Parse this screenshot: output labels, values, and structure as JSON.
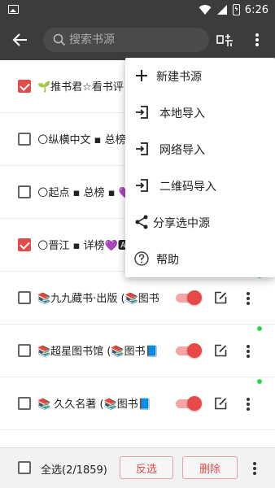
{
  "status_bar": {
    "time": "6:26",
    "battery_icon": "battery-charging-icon"
  },
  "toolbar": {
    "search_placeholder": "搜索书源"
  },
  "colors": {
    "accent": "#e24b4b",
    "toolbar_bg": "#3c3c3c",
    "enabled_dot": "#2bd94a"
  },
  "sources": [
    {
      "name": "🌱推书君☆看书评",
      "checked": true,
      "enabled": true
    },
    {
      "name": "🌕纵横中文 ▪ 总榜",
      "checked": false,
      "enabled": true
    },
    {
      "name": "🌕起点 ▪ 总榜 ▪ 💜",
      "checked": false,
      "enabled": true
    },
    {
      "name": "🌕晋江 ▪ 详榜💜🅰",
      "checked": true,
      "enabled": true
    },
    {
      "name": "📚九九藏书·出版 (📚图书",
      "checked": false,
      "enabled": true
    },
    {
      "name": "📚超星图书馆 (📚图书📘",
      "checked": false,
      "enabled": true
    },
    {
      "name": "📚 久久名著 (📚图书📘",
      "checked": false,
      "enabled": true
    }
  ],
  "menu": {
    "items": [
      {
        "label": "新建书源",
        "icon": "plus-icon"
      },
      {
        "label": "本地导入",
        "icon": "import-icon"
      },
      {
        "label": "网络导入",
        "icon": "import-icon"
      },
      {
        "label": "二维码导入",
        "icon": "import-icon"
      },
      {
        "label": "分享选中源",
        "icon": "share-icon"
      },
      {
        "label": "帮助",
        "icon": "help-icon"
      }
    ]
  },
  "bottom_bar": {
    "select_all_label": "全选(2/1859)",
    "invert_label": "反选",
    "delete_label": "删除"
  }
}
